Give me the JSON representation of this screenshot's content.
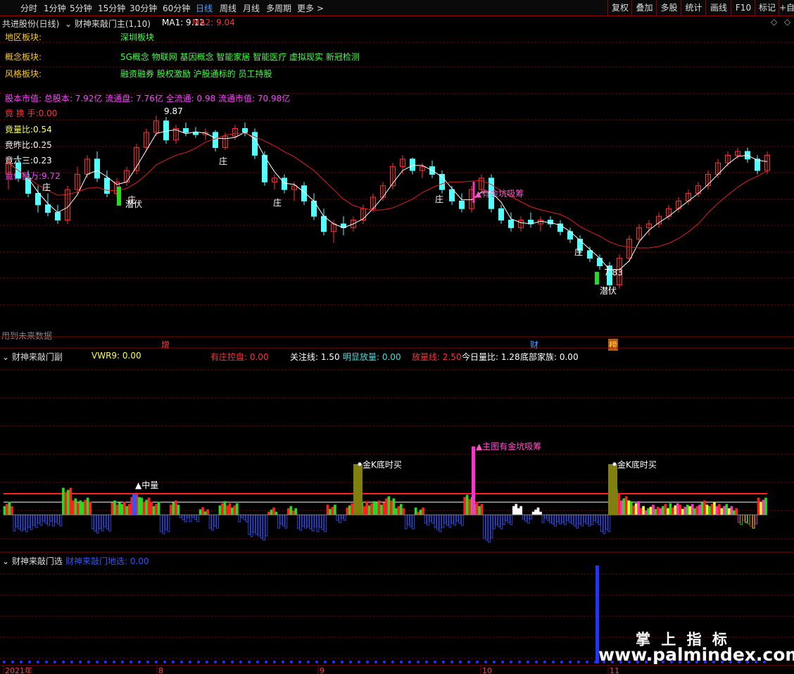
{
  "toolbar": {
    "periods": [
      "分时",
      "1分钟",
      "5分钟",
      "15分钟",
      "30分钟",
      "60分钟",
      "日线",
      "周线",
      "月线",
      "多周期",
      "更多 >"
    ],
    "active_index": 6,
    "right": [
      "复权",
      "叠加",
      "多股",
      "统计",
      "画线",
      "F10",
      "标记",
      "+自"
    ]
  },
  "main": {
    "title": "共进股份(日线)",
    "indicator": "财神来敲门主(1,10)",
    "ma1": "MA1: 9.12",
    "ma2": "MA2: 9.04",
    "info": [
      {
        "label": "地区板块:",
        "value": "深圳板块"
      },
      {
        "label": "概念板块:",
        "value": "5G概念 物联网 基因概念 智能家居 智能医疗 虚拟现实 新冠检测"
      },
      {
        "label": "风格板块:",
        "value": "融资融券 股权激励 沪股通标的 员工持股"
      }
    ],
    "capital": "股本市值: 总股本: 7.92亿 流通盘: 7.76亿 全流通: 0.98 流通市值: 70.98亿",
    "stats": [
      {
        "text": "竟 换 手:0.00",
        "color": "#ff3333"
      },
      {
        "text": "竟量比:0.54",
        "color": "#ffff66"
      },
      {
        "text": "竟昨比:0.25",
        "color": "#ffffff"
      },
      {
        "text": "竟六三:0.23",
        "color": "#ffffff"
      },
      {
        "text": "竟价额万:9.72",
        "color": "#ff44ff"
      }
    ],
    "future_note": "用到未来数据",
    "annotations": {
      "high": "9.87",
      "low": "7.83",
      "qianfu": "潜伏",
      "zhuang": "庄",
      "golden": "▲有金坑吸筹"
    },
    "markers": {
      "zeng": "增",
      "cai": "财",
      "bang": "榜"
    }
  },
  "sub": {
    "title": "财神来敲门副",
    "vwr": "VWR9: 0.00",
    "control": "有庄控盘: 0.00",
    "focus": "关注线: 1.50",
    "obvious": "明显放量: 0.00",
    "volume_line": "放量线: 2.50",
    "ratio": "今日量比: 1.28",
    "bottom": "底部家族: 0.00",
    "labels": {
      "zhongliang": "▲中量",
      "jink1": "金K底时买",
      "pink": "▲主图有金坑吸筹",
      "jink2": "金K底时买"
    }
  },
  "sel": {
    "title": "财神来敲门选",
    "pick": "财神来敲门地选: 0.00"
  },
  "xaxis": {
    "labels": [
      "2021年",
      "8",
      "9",
      "10",
      "11"
    ]
  },
  "watermark": {
    "line1": "掌 上 指 标",
    "line2": "www.palmindex.com"
  },
  "colors": {
    "up": "#ff3030",
    "down": "#54ffff",
    "ma1": "#ffffff",
    "ma2": "#e02020",
    "grid": "#8b0000"
  },
  "chart_data": [
    {
      "type": "candlestick",
      "price_range": [
        7.6,
        10.0
      ],
      "series_note": "daily OHLC",
      "ohlc": [
        [
          9.1,
          9.3,
          8.9,
          9.25
        ],
        [
          9.25,
          9.35,
          9.0,
          9.05
        ],
        [
          9.05,
          9.15,
          8.8,
          8.85
        ],
        [
          8.85,
          8.95,
          8.6,
          8.7
        ],
        [
          8.7,
          8.85,
          8.55,
          8.6
        ],
        [
          8.6,
          8.7,
          8.45,
          8.5
        ],
        [
          8.5,
          8.95,
          8.45,
          8.9
        ],
        [
          8.9,
          9.2,
          8.85,
          9.1
        ],
        [
          9.1,
          9.35,
          9.05,
          9.3
        ],
        [
          9.3,
          9.4,
          9.0,
          9.05
        ],
        [
          9.05,
          9.15,
          8.8,
          8.85
        ],
        [
          8.85,
          9.05,
          8.8,
          9.0
        ],
        [
          9.0,
          9.2,
          8.95,
          9.15
        ],
        [
          9.15,
          9.5,
          9.1,
          9.45
        ],
        [
          9.45,
          9.7,
          9.4,
          9.65
        ],
        [
          9.65,
          9.87,
          9.6,
          9.8
        ],
        [
          9.8,
          9.85,
          9.5,
          9.55
        ],
        [
          9.55,
          9.75,
          9.5,
          9.7
        ],
        [
          9.7,
          9.78,
          9.6,
          9.65
        ],
        [
          9.65,
          9.72,
          9.58,
          9.62
        ],
        [
          9.62,
          9.7,
          9.55,
          9.65
        ],
        [
          9.65,
          9.68,
          9.4,
          9.45
        ],
        [
          9.45,
          9.65,
          9.42,
          9.6
        ],
        [
          9.6,
          9.75,
          9.55,
          9.7
        ],
        [
          9.7,
          9.78,
          9.6,
          9.65
        ],
        [
          9.65,
          9.7,
          9.3,
          9.35
        ],
        [
          9.35,
          9.4,
          8.95,
          9.0
        ],
        [
          9.0,
          9.1,
          8.9,
          9.05
        ],
        [
          9.05,
          9.1,
          8.85,
          8.9
        ],
        [
          8.9,
          9.0,
          8.75,
          8.95
        ],
        [
          8.95,
          9.0,
          8.7,
          8.75
        ],
        [
          8.75,
          8.85,
          8.5,
          8.55
        ],
        [
          8.55,
          8.65,
          8.3,
          8.35
        ],
        [
          8.35,
          8.5,
          8.2,
          8.45
        ],
        [
          8.45,
          8.55,
          8.3,
          8.4
        ],
        [
          8.4,
          8.55,
          8.35,
          8.5
        ],
        [
          8.5,
          8.7,
          8.45,
          8.65
        ],
        [
          8.65,
          8.85,
          8.6,
          8.8
        ],
        [
          8.8,
          9.0,
          8.75,
          8.95
        ],
        [
          8.95,
          9.25,
          8.9,
          9.2
        ],
        [
          9.2,
          9.35,
          9.1,
          9.3
        ],
        [
          9.3,
          9.32,
          9.1,
          9.15
        ],
        [
          9.15,
          9.25,
          9.05,
          9.2
        ],
        [
          9.2,
          9.28,
          9.05,
          9.1
        ],
        [
          9.1,
          9.15,
          8.85,
          8.9
        ],
        [
          8.9,
          8.95,
          8.7,
          8.75
        ],
        [
          8.75,
          8.85,
          8.6,
          8.65
        ],
        [
          8.65,
          8.95,
          8.6,
          8.9
        ],
        [
          8.9,
          9.1,
          8.85,
          9.05
        ],
        [
          9.05,
          9.1,
          8.6,
          8.65
        ],
        [
          8.65,
          8.7,
          8.45,
          8.5
        ],
        [
          8.5,
          8.6,
          8.35,
          8.4
        ],
        [
          8.4,
          8.55,
          8.35,
          8.5
        ],
        [
          8.5,
          8.6,
          8.4,
          8.45
        ],
        [
          8.45,
          8.55,
          8.35,
          8.5
        ],
        [
          8.5,
          8.55,
          8.4,
          8.45
        ],
        [
          8.45,
          8.5,
          8.3,
          8.35
        ],
        [
          8.35,
          8.4,
          8.2,
          8.25
        ],
        [
          8.25,
          8.3,
          8.05,
          8.1
        ],
        [
          8.1,
          8.15,
          7.95,
          8.0
        ],
        [
          8.0,
          8.05,
          7.85,
          7.9
        ],
        [
          7.9,
          7.95,
          7.6,
          7.65
        ],
        [
          7.65,
          8.05,
          7.6,
          8.0
        ],
        [
          8.0,
          8.3,
          7.95,
          8.25
        ],
        [
          8.25,
          8.45,
          8.2,
          8.4
        ],
        [
          8.4,
          8.5,
          8.3,
          8.45
        ],
        [
          8.45,
          8.6,
          8.4,
          8.55
        ],
        [
          8.55,
          8.7,
          8.5,
          8.65
        ],
        [
          8.65,
          8.8,
          8.6,
          8.75
        ],
        [
          8.75,
          8.9,
          8.7,
          8.85
        ],
        [
          8.85,
          9.0,
          8.8,
          8.95
        ],
        [
          8.95,
          9.15,
          8.9,
          9.1
        ],
        [
          9.1,
          9.3,
          9.05,
          9.25
        ],
        [
          9.25,
          9.4,
          9.2,
          9.35
        ],
        [
          9.35,
          9.45,
          9.3,
          9.4
        ],
        [
          9.4,
          9.45,
          9.25,
          9.3
        ],
        [
          9.3,
          9.35,
          9.1,
          9.15
        ],
        [
          9.15,
          9.4,
          9.1,
          9.35
        ]
      ]
    },
    {
      "type": "bar",
      "name": "sub-indicator",
      "focus_line": 1.5,
      "volume_line": 2.5
    },
    {
      "type": "bar",
      "name": "selection-signal"
    }
  ]
}
